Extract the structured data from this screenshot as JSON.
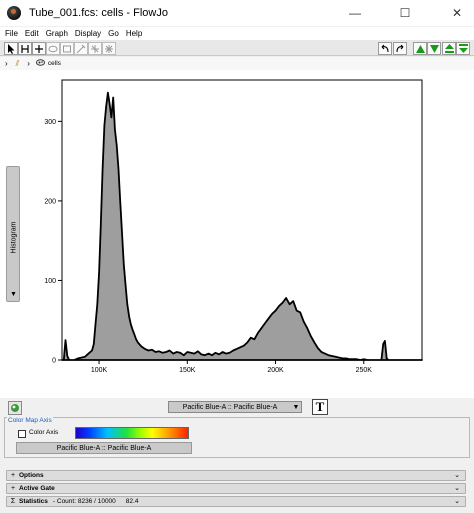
{
  "window": {
    "title": "Tube_001.fcs: cells - FlowJo",
    "minimize_glyph": "—",
    "maximize_glyph": "☐",
    "close_glyph": "✕"
  },
  "menu": [
    "File",
    "Edit",
    "Graph",
    "Display",
    "Go",
    "Help"
  ],
  "toolbar": {
    "left_icons": [
      "pointer-icon",
      "vertical-bisector-icon",
      "bisector-icon",
      "ellipse-gate-icon",
      "polygon-gate-icon",
      "freehand-gate-icon",
      "quadrant-gate-icon",
      "spider-gate-icon"
    ],
    "right_icons": [
      "undo-icon",
      "redo-icon",
      "previous-population-icon",
      "next-population-icon",
      "previous-sample-icon",
      "next-sample-icon"
    ]
  },
  "breadcrumb": {
    "expand_glyph": "›",
    "tube_glyph": "⫽",
    "separator": "›",
    "gate_label": "cells"
  },
  "side_tab": {
    "label": "Histogram",
    "arrow": "▼"
  },
  "bottom": {
    "parameter_select": "Pacific Blue-A :: Pacific Blue-A",
    "text_button": "T"
  },
  "color_map": {
    "title": "Color Map Axis",
    "checkbox_label": "Color Axis",
    "checked": false,
    "parameter": "Pacific Blue-A :: Pacific Blue-A"
  },
  "sections": {
    "options": {
      "label": "Options",
      "mark": "+"
    },
    "active_gate": {
      "label": "Active Gate",
      "mark": "+"
    },
    "statistics": {
      "label": "Statistics",
      "mark": "Σ",
      "count_text": "- Count: 8236 / 10000",
      "percent": "82.4"
    }
  },
  "colors": {
    "histogram_fill": "#9e9e9e",
    "histogram_stroke": "#000000",
    "link_blue": "#1f5fbf",
    "arrow_green": "#1a9a1a"
  },
  "chart_data": {
    "type": "area",
    "x_axis": {
      "label": "",
      "ticks": [
        100000,
        150000,
        200000,
        250000
      ],
      "tick_labels": [
        "100K",
        "150K",
        "200K",
        "250K"
      ],
      "range": [
        79000,
        283000
      ]
    },
    "y_axis": {
      "label": "",
      "ticks": [
        0,
        100,
        200,
        300
      ],
      "tick_labels": [
        "0",
        "100",
        "200",
        "300"
      ],
      "range": [
        0,
        352
      ]
    },
    "grid": false,
    "legend": "none",
    "series": [
      {
        "x": [
          79000,
          80000,
          81000,
          82000,
          83000,
          84000,
          85000,
          86000,
          88000,
          90000,
          92000,
          94000,
          96000,
          97000,
          98000,
          99000,
          100000,
          101000,
          102000,
          103000,
          104000,
          105000,
          106000,
          107000,
          108000,
          109000,
          110000,
          111000,
          112000,
          113000,
          114000,
          115000,
          116000,
          117000,
          118000,
          119000,
          120000,
          121000,
          122000,
          124000,
          126000,
          128000,
          130000,
          132000,
          134000,
          136000,
          138000,
          140000,
          142000,
          144000,
          146000,
          148000,
          150000,
          152000,
          154000,
          156000,
          158000,
          160000,
          162000,
          164000,
          166000,
          168000,
          170000,
          172000,
          174000,
          176000,
          178000,
          180000,
          182000,
          184000,
          186000,
          188000,
          190000,
          192000,
          194000,
          196000,
          198000,
          200000,
          202000,
          204000,
          206000,
          208000,
          210000,
          212000,
          214000,
          216000,
          218000,
          220000,
          222000,
          224000,
          226000,
          228000,
          230000,
          232000,
          234000,
          236000,
          238000,
          240000,
          242000,
          244000,
          246000,
          248000,
          250000,
          252000,
          254000,
          256000,
          258000,
          260000,
          261000,
          262000,
          263000,
          264000,
          266000,
          268000,
          270000,
          272000,
          274000,
          276000,
          278000,
          280000,
          282000,
          283000
        ],
        "y": [
          0,
          0,
          25,
          5,
          0,
          0,
          0,
          0,
          2,
          3,
          4,
          8,
          12,
          20,
          45,
          70,
          110,
          170,
          240,
          295,
          318,
          336,
          322,
          305,
          330,
          290,
          270,
          240,
          200,
          160,
          120,
          95,
          70,
          55,
          45,
          38,
          32,
          26,
          22,
          17,
          14,
          12,
          13,
          10,
          11,
          9,
          10,
          12,
          8,
          10,
          9,
          6,
          10,
          9,
          8,
          11,
          7,
          6,
          8,
          6,
          9,
          7,
          10,
          8,
          9,
          12,
          14,
          16,
          18,
          22,
          28,
          26,
          34,
          40,
          46,
          52,
          58,
          62,
          68,
          72,
          78,
          70,
          74,
          62,
          60,
          48,
          40,
          30,
          22,
          15,
          10,
          8,
          6,
          5,
          4,
          3,
          2,
          2,
          1,
          1,
          1,
          0,
          1,
          0,
          0,
          0,
          0,
          0,
          20,
          24,
          2,
          0,
          0,
          0,
          0,
          0,
          0,
          0,
          0,
          0,
          0,
          0
        ]
      }
    ]
  }
}
